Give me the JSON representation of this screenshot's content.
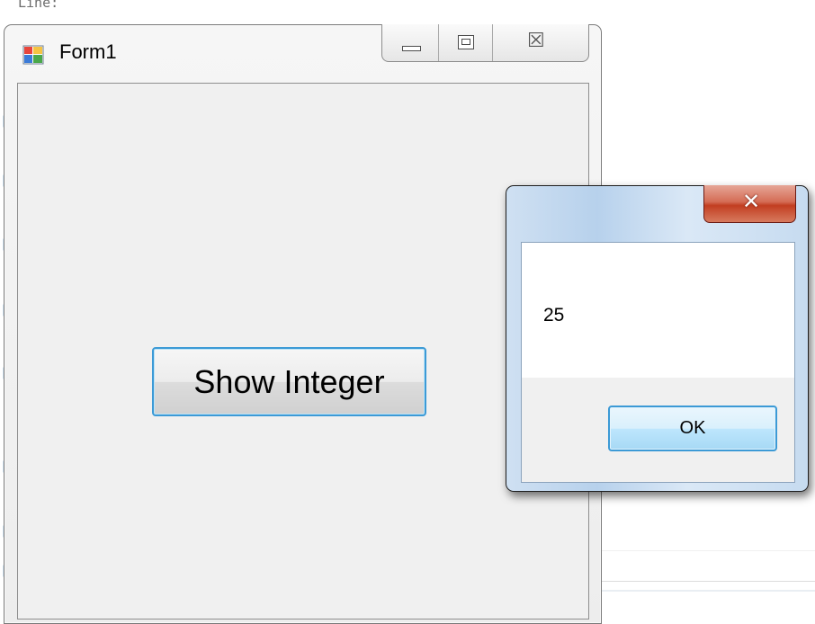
{
  "background": {
    "code_text": "Line:"
  },
  "form1": {
    "title": "Form1",
    "icon": "winforms-app-icon",
    "caption_buttons": {
      "minimize_icon": "minimize-icon",
      "maximize_icon": "maximize-icon",
      "close_glyph": "☒"
    },
    "show_button_label": "Show Integer"
  },
  "message_box": {
    "close_glyph": "✕",
    "message": "25",
    "ok_label": "OK"
  },
  "colors": {
    "button_focus_border": "#3c9ad6",
    "close_button_red": "#c23e21",
    "aero_frame": "#cfe0f2"
  }
}
